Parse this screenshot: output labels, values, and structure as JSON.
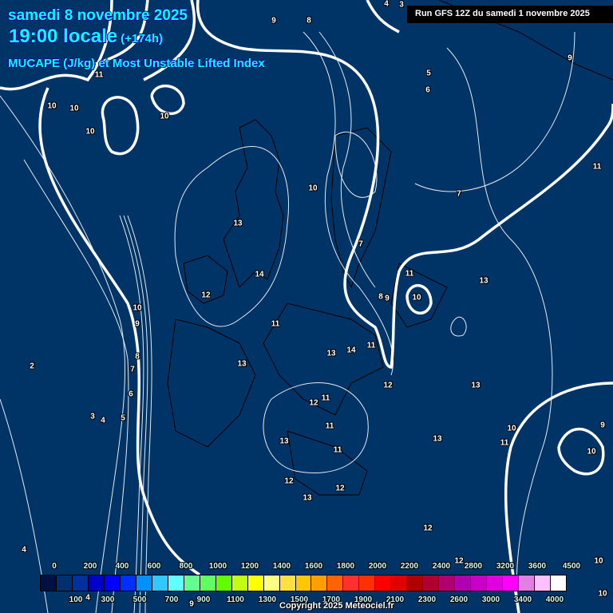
{
  "header": {
    "date": "samedi 8 novembre 2025",
    "time": "19:00 locale",
    "offset": "(+174h)",
    "product": "MUCAPE (J/kg) et Most Unstable Lifted Index",
    "run": "Run GFS 12Z du samedi 1 novembre 2025"
  },
  "contour_labels": [
    "9",
    "8",
    "4",
    "3",
    "11",
    "10",
    "10",
    "10",
    "10",
    "5",
    "6",
    "9",
    "11",
    "7",
    "10",
    "13",
    "14",
    "12",
    "7",
    "11",
    "10",
    "13",
    "8",
    "9",
    "10",
    "9",
    "8",
    "7",
    "6",
    "5",
    "4",
    "3",
    "2",
    "11",
    "13",
    "14",
    "11",
    "12",
    "13",
    "12",
    "11",
    "11",
    "11",
    "13",
    "13",
    "10",
    "11",
    "10",
    "9",
    "13",
    "12",
    "13",
    "12",
    "12",
    "4",
    "10",
    "10",
    "4",
    "9",
    "12"
  ],
  "legend": {
    "top_labels": [
      "0",
      "200",
      "400",
      "600",
      "800",
      "1000",
      "1200",
      "1400",
      "1600",
      "1800",
      "2000",
      "2200",
      "2400",
      "2800",
      "3200",
      "3600",
      "4500"
    ],
    "bottom_labels": [
      "100",
      "300",
      "500",
      "700",
      "900",
      "1100",
      "1300",
      "1500",
      "1700",
      "1900",
      "2100",
      "2300",
      "2600",
      "3000",
      "3400",
      "4000"
    ],
    "colors": [
      "#001040",
      "#003070",
      "#0030a0",
      "#0000c8",
      "#0000ff",
      "#0030ff",
      "#0090ff",
      "#30c8ff",
      "#60ffff",
      "#60ff90",
      "#60ff60",
      "#60ff00",
      "#c0ff10",
      "#ffff00",
      "#ffff80",
      "#ffe040",
      "#ffc800",
      "#ffa000",
      "#ff6400",
      "#ff3030",
      "#ff3000",
      "#ff0000",
      "#e00000",
      "#b00000",
      "#b00030",
      "#b00070",
      "#b000b0",
      "#c800c8",
      "#e000e0",
      "#ff00ff",
      "#e080e0",
      "#ffc0ff",
      "#ffffff"
    ]
  },
  "copyright": "Copyright 2025 Meteociel.fr"
}
